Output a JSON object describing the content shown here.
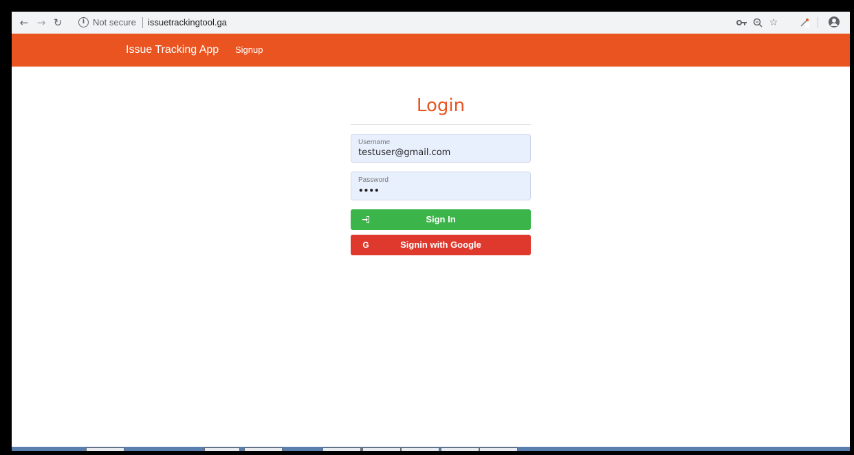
{
  "browser": {
    "security_label": "Not secure",
    "url": "issuetrackingtool.ga",
    "icons": [
      "back-arrow-icon",
      "forward-arrow-icon",
      "reload-icon",
      "info-icon",
      "key-icon",
      "zoom-icon",
      "star-icon",
      "eyedropper-icon",
      "profile-icon"
    ]
  },
  "navbar": {
    "brand": "Issue Tracking App",
    "signup_link": "Signup",
    "color": "#e95420"
  },
  "login": {
    "title": "Login",
    "username": {
      "label": "Username",
      "value": "testuser@gmail.com"
    },
    "password": {
      "label": "Password",
      "value": "••••"
    },
    "signin_button": "Sign In",
    "google_button": "Signin with Google",
    "google_glyph": "G",
    "colors": {
      "title": "#e95420",
      "signin": "#3bb54a",
      "google": "#df382c",
      "field_bg": "#e8f0fe"
    }
  }
}
